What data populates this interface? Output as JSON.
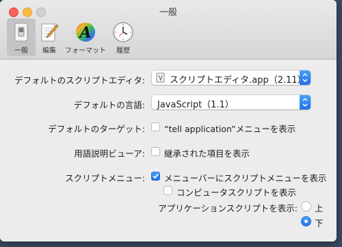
{
  "window": {
    "title": "一般"
  },
  "toolbar": {
    "items": [
      {
        "label": "一般",
        "icon": "general-switch-icon"
      },
      {
        "label": "編集",
        "icon": "edit-notepad-icon"
      },
      {
        "label": "フォーマット",
        "icon": "format-color-a-icon"
      },
      {
        "label": "履歴",
        "icon": "history-clock-icon"
      }
    ]
  },
  "settings": {
    "default_editor": {
      "label": "デフォルトのスクリプトエディタ:",
      "value": "スクリプトエディタ.app（2.11）"
    },
    "default_language": {
      "label": "デフォルトの言語:",
      "value": "JavaScript（1.1）"
    },
    "default_target": {
      "label": "デフォルトのターゲット:",
      "checkbox_label": "“tell application”メニューを表示",
      "checked": false
    },
    "glossary_viewer": {
      "label": "用語説明ビューア:",
      "checkbox_label": "継承された項目を表示",
      "checked": false
    },
    "script_menu": {
      "label": "スクリプトメニュー:",
      "menubar_checkbox_label": "メニューバーにスクリプトメニューを表示",
      "menubar_checked": true,
      "computer_checkbox_label": "コンピュータスクリプトを表示",
      "computer_checked": false,
      "app_scripts_label": "アプリケーションスクリプトを表示:",
      "option_top": "上",
      "option_bottom": "下",
      "selected": "下"
    }
  },
  "colors": {
    "accent": "#1f73e8",
    "window_bg": "#ececec",
    "desktop": "#3a4a63"
  }
}
